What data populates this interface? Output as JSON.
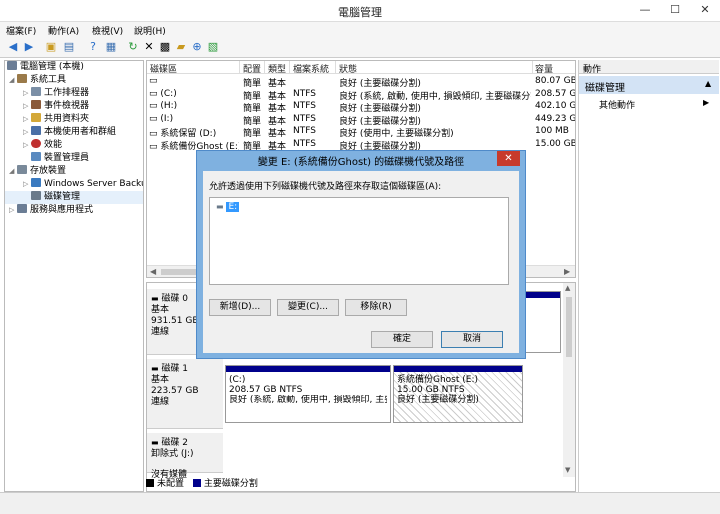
{
  "window": {
    "title": "電腦管理",
    "min": "—",
    "max": "☐",
    "close": "✕"
  },
  "menu": [
    "檔案(F)",
    "動作(A)",
    "檢視(V)",
    "說明(H)"
  ],
  "tree": {
    "root": "電腦管理 (本機)",
    "system_tools": "系統工具",
    "task_scheduler": "工作排程器",
    "event_viewer": "事件檢視器",
    "shared_folders": "共用資料夾",
    "local_users": "本機使用者和群組",
    "performance": "效能",
    "device_manager": "裝置管理員",
    "storage": "存放裝置",
    "windows_backup": "Windows Server Backu",
    "disk_management": "磁碟管理",
    "services": "服務與應用程式"
  },
  "volumes": {
    "headers": [
      "磁碟區",
      "配置",
      "類型",
      "檔案系統",
      "狀態",
      "容量"
    ],
    "rows": [
      {
        "name": "",
        "layout": "簡單",
        "type": "基本",
        "fs": "",
        "status": "良好 (主要磁碟分割)",
        "capacity": "80.07 GB"
      },
      {
        "name": "(C:)",
        "layout": "簡單",
        "type": "基本",
        "fs": "NTFS",
        "status": "良好 (系統, 啟動, 使用中, 損毀傾印, 主要磁碟分割)",
        "capacity": "208.57 GE"
      },
      {
        "name": "(H:)",
        "layout": "簡單",
        "type": "基本",
        "fs": "NTFS",
        "status": "良好 (主要磁碟分割)",
        "capacity": "402.10 GE"
      },
      {
        "name": "(I:)",
        "layout": "簡單",
        "type": "基本",
        "fs": "NTFS",
        "status": "良好 (主要磁碟分割)",
        "capacity": "449.23 GE"
      },
      {
        "name": "系統保留 (D:)",
        "layout": "簡單",
        "type": "基本",
        "fs": "NTFS",
        "status": "良好 (使用中, 主要磁碟分割)",
        "capacity": "100 MB"
      },
      {
        "name": "系統備份Ghost (E:)",
        "layout": "簡單",
        "type": "基本",
        "fs": "NTFS",
        "status": "良好 (主要磁碟分割)",
        "capacity": "15.00 GB"
      }
    ]
  },
  "disks": {
    "disk0": {
      "name": "磁碟 0",
      "type": "基本",
      "size": "931.51 GB",
      "status": "連線"
    },
    "disk1": {
      "name": "磁碟 1",
      "type": "基本",
      "size": "223.57 GB",
      "status": "連線"
    },
    "disk2": {
      "name": "磁碟 2",
      "type": "卸除式 (J:)",
      "media": "沒有媒體"
    },
    "part_c": {
      "name": "(C:)",
      "size": "208.57 GB NTFS",
      "status": "良好 (系統, 啟動, 使用中, 損毀傾印, 主要磁"
    },
    "part_e": {
      "name": "系統備份Ghost (E:)",
      "size": "15.00 GB NTFS",
      "status": "良好 (主要磁碟分割)"
    }
  },
  "legend": {
    "unallocated": "未配置",
    "primary": "主要磁碟分割"
  },
  "actions": {
    "title": "動作",
    "section": "磁碟管理",
    "more": "其他動作"
  },
  "dialog": {
    "title": "變更 E: (系統備份Ghost) 的磁碟機代號及路徑",
    "description": "允許透過使用下列磁碟機代號及路徑來存取這個磁碟區(A):",
    "item": "E:",
    "add": "新增(D)...",
    "change": "變更(C)...",
    "remove": "移除(R)",
    "ok": "確定",
    "cancel": "取消"
  },
  "colors": {
    "primary_partition": "#00008b",
    "unallocated": "#000000",
    "dialog_frame": "#7fb1e0",
    "close_red": "#c73a2b",
    "selection": "#3399ff"
  }
}
